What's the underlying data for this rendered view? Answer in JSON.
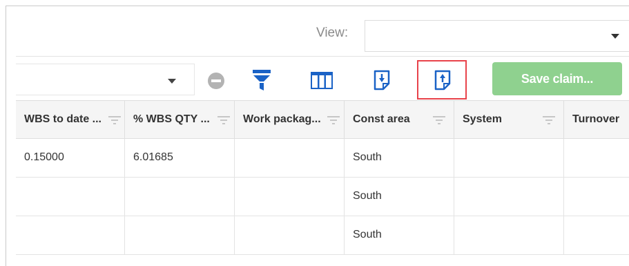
{
  "view": {
    "label": "View:",
    "value": ""
  },
  "toolbar": {
    "select_value": "",
    "save_label": "Save claim..."
  },
  "colors": {
    "accent_blue": "#1a62c6",
    "save_green": "#8fd18f",
    "highlight_red": "#e8424a",
    "minus_gray": "#b3b3b3"
  },
  "icons": {
    "minus": "minus-circle-icon",
    "filter": "filter-icon",
    "columns": "columns-icon",
    "export": "export-document-icon",
    "import": "import-document-icon",
    "sort": "filter-lines-icon"
  },
  "table": {
    "columns": [
      {
        "label": "WBS to date ..."
      },
      {
        "label": "% WBS QTY ..."
      },
      {
        "label": "Work packag..."
      },
      {
        "label": "Const area"
      },
      {
        "label": "System"
      },
      {
        "label": "Turnover"
      }
    ],
    "rows": [
      [
        "0.15000",
        "6.01685",
        "",
        "South",
        "",
        ""
      ],
      [
        "",
        "",
        "",
        "South",
        "",
        ""
      ],
      [
        "",
        "",
        "",
        "South",
        "",
        ""
      ]
    ]
  }
}
